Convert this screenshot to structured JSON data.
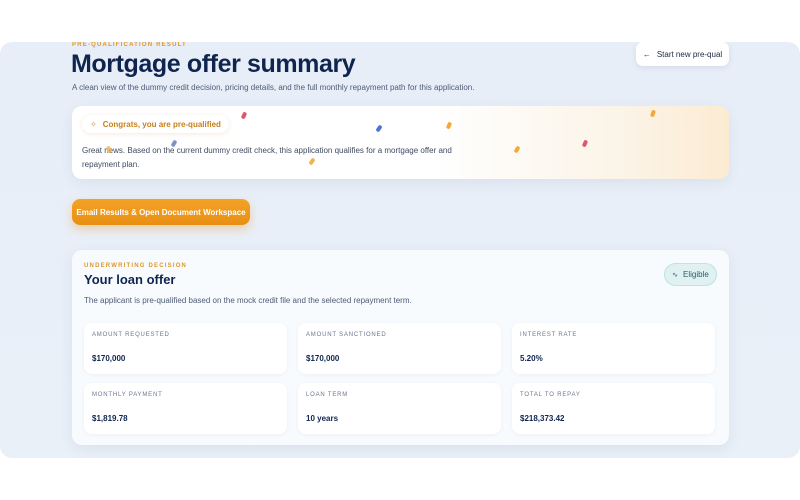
{
  "header": {
    "eyebrow": "PRE-QUALIFICATION RESULT",
    "title": "Mortgage offer summary",
    "subtitle": "A clean view of the dummy credit decision, pricing details, and the full monthly repayment path for this application.",
    "start_button_label": "Start new pre-qual",
    "start_button_icon": "arrow-left-icon"
  },
  "congrats": {
    "pill_label": "Congrats, you are pre-qualified",
    "pill_icon": "sparkle-icon",
    "message": "Great news. Based on the current dummy credit check, this application qualifies for a mortgage offer and repayment plan.",
    "confetti_colors": [
      "#e0566a",
      "#4a74d8",
      "#f0b44a",
      "#f2a93b"
    ]
  },
  "actions": {
    "email_button_label": "Email Results & Open Document Workspace",
    "accent_color": "#ee9716"
  },
  "offer": {
    "eyebrow": "UNDERWRITING DECISION",
    "title": "Your loan offer",
    "description": "The applicant is pre-qualified based on the mock credit file and the selected repayment term.",
    "status_badge": "Eligible",
    "status_icon": "pulse-icon",
    "metrics": [
      {
        "label": "AMOUNT REQUESTED",
        "value": "$170,000"
      },
      {
        "label": "AMOUNT SANCTIONED",
        "value": "$170,000"
      },
      {
        "label": "INTEREST RATE",
        "value": "5.20%"
      },
      {
        "label": "MONTHLY PAYMENT",
        "value": "$1,819.78"
      },
      {
        "label": "LOAN TERM",
        "value": "10 years"
      },
      {
        "label": "TOTAL TO REPAY",
        "value": "$218,373.42"
      }
    ]
  }
}
